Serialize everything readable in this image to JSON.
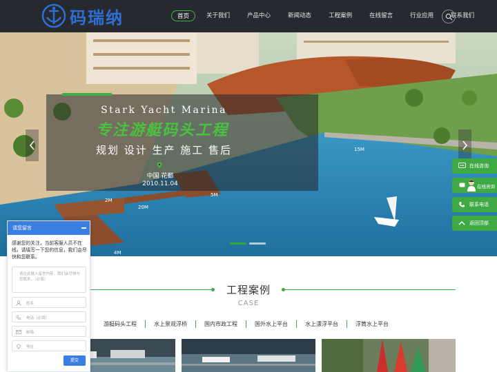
{
  "header": {
    "logo_text": "码瑞纳",
    "nav": [
      {
        "label": "首页",
        "active": true
      },
      {
        "label": "关于我们"
      },
      {
        "label": "产品中心"
      },
      {
        "label": "新闻动态"
      },
      {
        "label": "工程案例"
      },
      {
        "label": "在线留言"
      },
      {
        "label": "行业应用"
      },
      {
        "label": "联系我们"
      }
    ],
    "search_icon": "search-icon"
  },
  "banner": {
    "title_en": "Stark Yacht Marina",
    "title_cn": "专注游艇码头工程",
    "subtitle": "规划 设计 生产 施工 售后",
    "place": "中国 花都",
    "date": "2010.11.04",
    "scene_labels": [
      "15M",
      "2M",
      "20M",
      "5M",
      "4M"
    ],
    "slides": 2,
    "active_slide": 1
  },
  "side_buttons": {
    "online": "在线咨询",
    "consult": "在线咨询",
    "phone": "联系电话",
    "top": "返回顶部"
  },
  "cases": {
    "title": "工程案例",
    "subtitle": "CASE",
    "categories": [
      "游艇码头工程",
      "水上景观浮桥",
      "国内市政工程",
      "国外水上平台",
      "水上漂浮平台",
      "浮筒水上平台"
    ]
  },
  "chat": {
    "title": "请您留言",
    "message": "感谢您的关注，当前客服人员不在线，请填写一下您的信息，我们会尽快和您联系。",
    "content_placeholder": "请在此输入留言内容，我们会尽快与您联系。（必填）",
    "fields": [
      {
        "placeholder": "姓名",
        "icon": "user-icon"
      },
      {
        "placeholder": "电话（必填）",
        "icon": "phone-icon"
      },
      {
        "placeholder": "邮箱",
        "icon": "mail-icon"
      },
      {
        "placeholder": "地址",
        "icon": "location-icon"
      }
    ],
    "submit": "提交"
  },
  "colors": {
    "header_bg": "#262a30",
    "logo_blue": "#2f6fd3",
    "accent_green": "#3faa44",
    "chat_blue": "#3a7ee2"
  }
}
